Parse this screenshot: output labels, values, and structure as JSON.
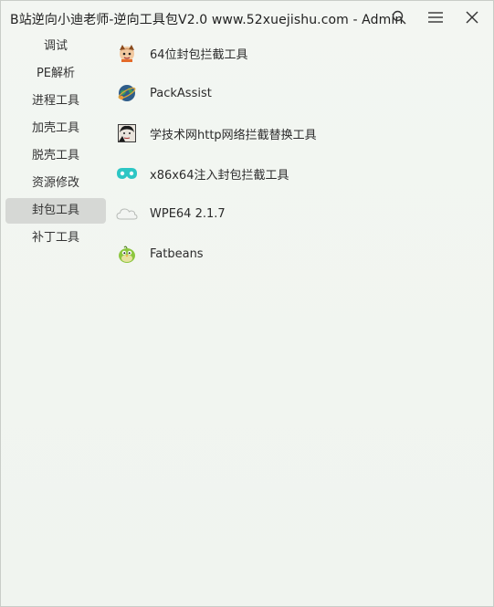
{
  "window": {
    "title": "B站逆向小迪老师-逆向工具包V2.0 www.52xuejishu.com - Admin"
  },
  "titlebar": {
    "buttons": [
      {
        "icon": "search-icon"
      },
      {
        "icon": "menu-icon"
      },
      {
        "icon": "close-icon"
      }
    ]
  },
  "sidebar": {
    "items": [
      {
        "label": "调试"
      },
      {
        "label": "PE解析"
      },
      {
        "label": "进程工具"
      },
      {
        "label": "加壳工具"
      },
      {
        "label": "脱壳工具"
      },
      {
        "label": "资源修改"
      },
      {
        "label": "封包工具",
        "active": true
      },
      {
        "label": "补丁工具"
      }
    ]
  },
  "tools": {
    "items": [
      {
        "label": "64位封包拦截工具",
        "icon": "fox-icon"
      },
      {
        "label": "PackAssist",
        "icon": "globe-icon"
      },
      {
        "label": "学技术网http网络拦截替换工具",
        "icon": "portrait-icon"
      },
      {
        "label": "x86x64注入封包拦截工具",
        "icon": "mask-icon"
      },
      {
        "label": "WPE64 2.1.7",
        "icon": "cloud-icon"
      },
      {
        "label": "Fatbeans",
        "icon": "bird-icon"
      }
    ]
  }
}
